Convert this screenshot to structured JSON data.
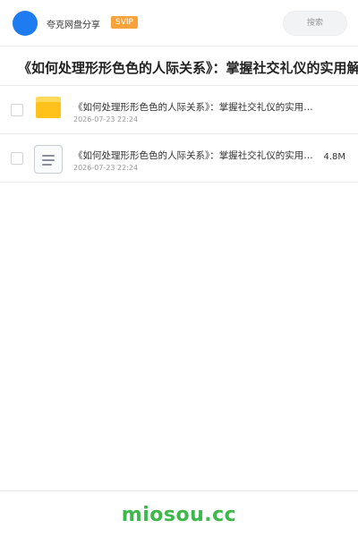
{
  "header": {
    "user_name": "夸克网盘分享",
    "vip_badge": "SVIP",
    "search_placeholder": "搜索",
    "accent_color": "#1f7cf0"
  },
  "title": "《如何处理形形色色的人际关系》：掌握社交礼仪的实用解",
  "files": [
    {
      "icon": "folder-icon",
      "name": "《如何处理形形色色的人际关系》：掌握社交礼仪的实用…",
      "date": "2026-07-23 22:24",
      "size": ""
    },
    {
      "icon": "document-icon",
      "name": "《如何处理形形色色的人际关系》：掌握社交礼仪的实用…",
      "date": "2026-07-23 22:24",
      "size": "4.8M"
    }
  ],
  "footer": {
    "brand": "miosou.cc",
    "brand_color": "#3cb94a"
  }
}
